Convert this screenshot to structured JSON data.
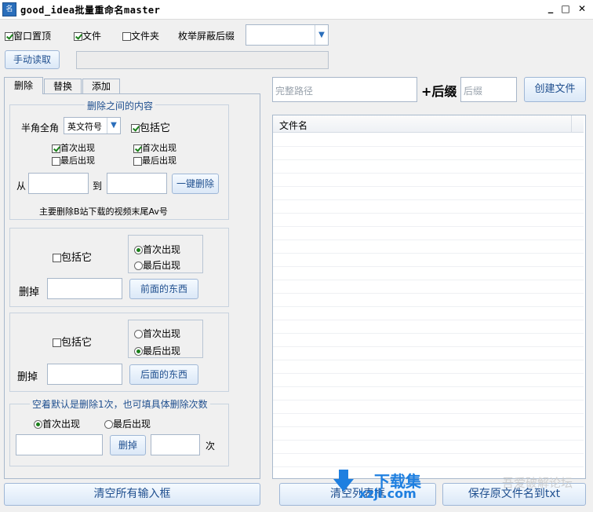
{
  "window": {
    "title": "good_idea批量重命名master",
    "minimize": "_",
    "maximize": "□",
    "close": "✕"
  },
  "toolbar": {
    "topmost_label": "窗口置顶",
    "topmost_checked": true,
    "file_label": "文件",
    "file_checked": true,
    "folder_label": "文件夹",
    "folder_checked": false,
    "enum_hide_label": "枚举屏蔽后缀",
    "enum_hide_value": "",
    "manual_read_label": "手动读取",
    "path_value": ""
  },
  "tabs": [
    {
      "label": "删除"
    },
    {
      "label": "替换"
    },
    {
      "label": "添加"
    }
  ],
  "between_group": {
    "title": "删除之间的内容",
    "halffull_label": "半角全角",
    "symbol_select": "英文符号",
    "include_label": "包括它",
    "include_checked": true,
    "left_first": "首次出现",
    "left_first_checked": true,
    "left_last": "最后出现",
    "left_last_checked": false,
    "right_first": "首次出现",
    "right_first_checked": true,
    "right_last": "最后出现",
    "right_last_checked": false,
    "from_label": "从",
    "to_label": "到",
    "from_value": "",
    "to_value": "",
    "delete_button": "一键删除",
    "hint": "主要删除B站下载的视频末尾Av号"
  },
  "front_group": {
    "include_label": "包括它",
    "include_checked": false,
    "first_label": "首次出现",
    "first_selected": true,
    "last_label": "最后出现",
    "last_selected": false,
    "delete_label": "删掉",
    "value": "",
    "button": "前面的东西"
  },
  "back_group": {
    "include_label": "包括它",
    "include_checked": false,
    "first_label": "首次出现",
    "first_selected": false,
    "last_label": "最后出现",
    "last_selected": true,
    "delete_label": "删掉",
    "value": "",
    "button": "后面的东西"
  },
  "count_group": {
    "title": "空着默认是删除1次，也可填具体删除次数",
    "first_label": "首次出现",
    "first_selected": true,
    "last_label": "最后出现",
    "last_selected": false,
    "text_value": "",
    "delete_button": "删掉",
    "count_value": "",
    "times_label": "次"
  },
  "right": {
    "full_path_placeholder": "完整路径",
    "plus_suffix_label": "+后缀",
    "suffix_placeholder": "后缀",
    "create_file_button": "创建文件",
    "list_header": "文件名"
  },
  "bottom": {
    "clear_all_button": "清空所有输入框",
    "clear_list_button": "清空列表框",
    "save_txt_button": "保存原文件名到txt"
  },
  "watermark": {
    "brand": "下载集",
    "site": "xzji.com",
    "right_text": "吾爱破解论坛"
  },
  "colors": {
    "accent": "#1f4f8f",
    "check": "#1a7f1a",
    "border": "#a9b9cc"
  }
}
